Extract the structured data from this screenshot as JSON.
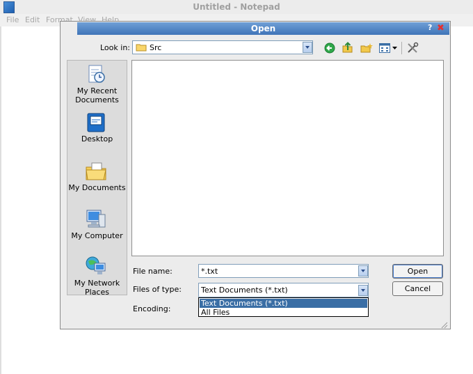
{
  "notepad": {
    "title": "Untitled - Notepad",
    "menu": [
      "File",
      "Edit",
      "Format",
      "View",
      "Help"
    ]
  },
  "dialog": {
    "title": "Open",
    "help_glyph": "?",
    "close_glyph": "✖",
    "look_in_label": "Look in:",
    "look_in_value": "Src",
    "places": [
      {
        "label": "My Recent Documents",
        "icon": "recent-documents-icon"
      },
      {
        "label": "Desktop",
        "icon": "desktop-icon"
      },
      {
        "label": "My Documents",
        "icon": "my-documents-icon"
      },
      {
        "label": "My Computer",
        "icon": "my-computer-icon"
      },
      {
        "label": "My Network Places",
        "icon": "network-places-icon"
      }
    ],
    "file_name_label": "File name:",
    "file_name_value": "*.txt",
    "files_of_type_label": "Files of type:",
    "files_of_type_value": "Text Documents (*.txt)",
    "encoding_label": "Encoding:",
    "open_button": "Open",
    "cancel_button": "Cancel",
    "type_options": [
      "Text Documents (*.txt)",
      "All Files"
    ],
    "selected_type_index": 0
  }
}
